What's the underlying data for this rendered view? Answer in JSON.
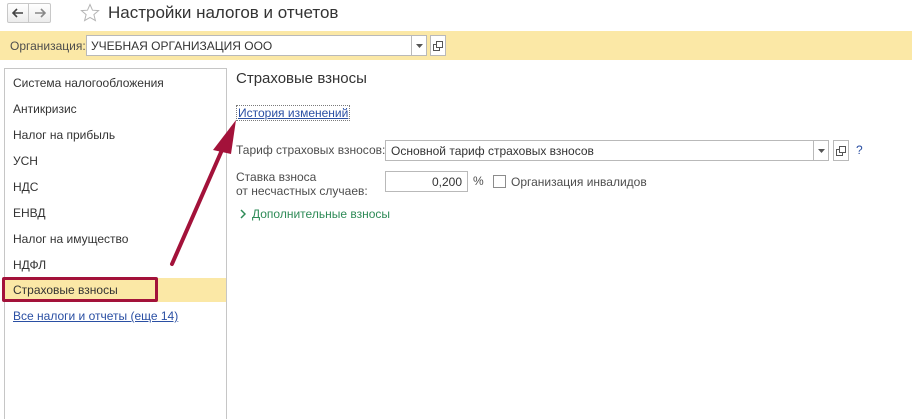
{
  "window": {
    "title": "Настройки налогов и отчетов"
  },
  "organization": {
    "label": "Организация:",
    "value": "УЧЕБНАЯ ОРГАНИЗАЦИЯ ООО"
  },
  "sidebar": {
    "items": [
      {
        "label": "Система налогообложения"
      },
      {
        "label": "Антикризис"
      },
      {
        "label": "Налог на прибыль"
      },
      {
        "label": "УСН"
      },
      {
        "label": "НДС"
      },
      {
        "label": "ЕНВД"
      },
      {
        "label": "Налог на имущество"
      },
      {
        "label": "НДФЛ"
      },
      {
        "label": "Страховые взносы"
      }
    ],
    "all_link": "Все налоги и отчеты (еще 14)"
  },
  "main": {
    "title": "Страховые взносы",
    "history_link": "История изменений",
    "tariff_label": "Тариф страховых взносов:",
    "tariff_value": "Основной тариф страховых взносов",
    "help": "?",
    "rate_label_1": "Ставка взноса",
    "rate_label_2": "от несчастных случаев:",
    "rate_value": "0,200",
    "rate_unit": "%",
    "disabled_org_label": "Организация инвалидов",
    "extra_toggle": "Дополнительные взносы"
  },
  "colors": {
    "accent_yellow": "#fbe8a6",
    "link_blue": "#2a4fa3",
    "toggle_green": "#2e8b57",
    "annotation_red": "#a3123a"
  }
}
